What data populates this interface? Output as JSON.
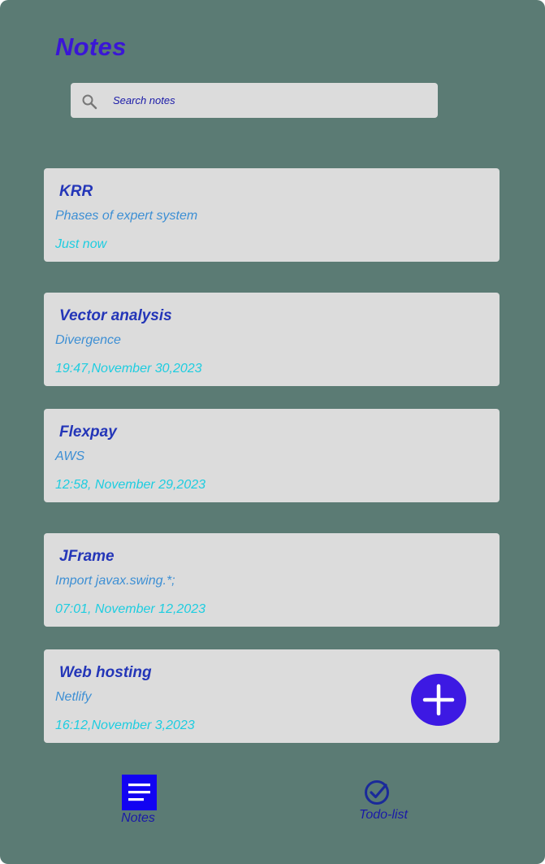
{
  "header": {
    "title": "Notes"
  },
  "search": {
    "placeholder": "Search notes",
    "icon": "search-icon"
  },
  "notes": [
    {
      "title": "KRR",
      "subtitle": "Phases of expert system",
      "time": "Just now"
    },
    {
      "title": "Vector analysis",
      "subtitle": "Divergence",
      "time": "19:47,November 30,2023"
    },
    {
      "title": "Flexpay",
      "subtitle": "AWS",
      "time": "12:58, November 29,2023"
    },
    {
      "title": "JFrame",
      "subtitle": "Import javax.swing.*;",
      "time": "07:01, November 12,2023"
    },
    {
      "title": "Web hosting",
      "subtitle": "Netlify",
      "time": "16:12,November 3,2023"
    }
  ],
  "fab": {
    "icon": "plus-icon"
  },
  "bottom_nav": {
    "notes": {
      "label": "Notes",
      "icon": "notes-list-icon"
    },
    "todo": {
      "label": "Todo-list",
      "icon": "check-circle-icon"
    }
  },
  "colors": {
    "background": "#5b7b74",
    "card": "#dcdcdc",
    "accent": "#3d19e3",
    "title": "#3a16d6",
    "note_title": "#2436b8",
    "note_subtitle": "#3d8fd4",
    "note_time": "#1ecde0"
  }
}
